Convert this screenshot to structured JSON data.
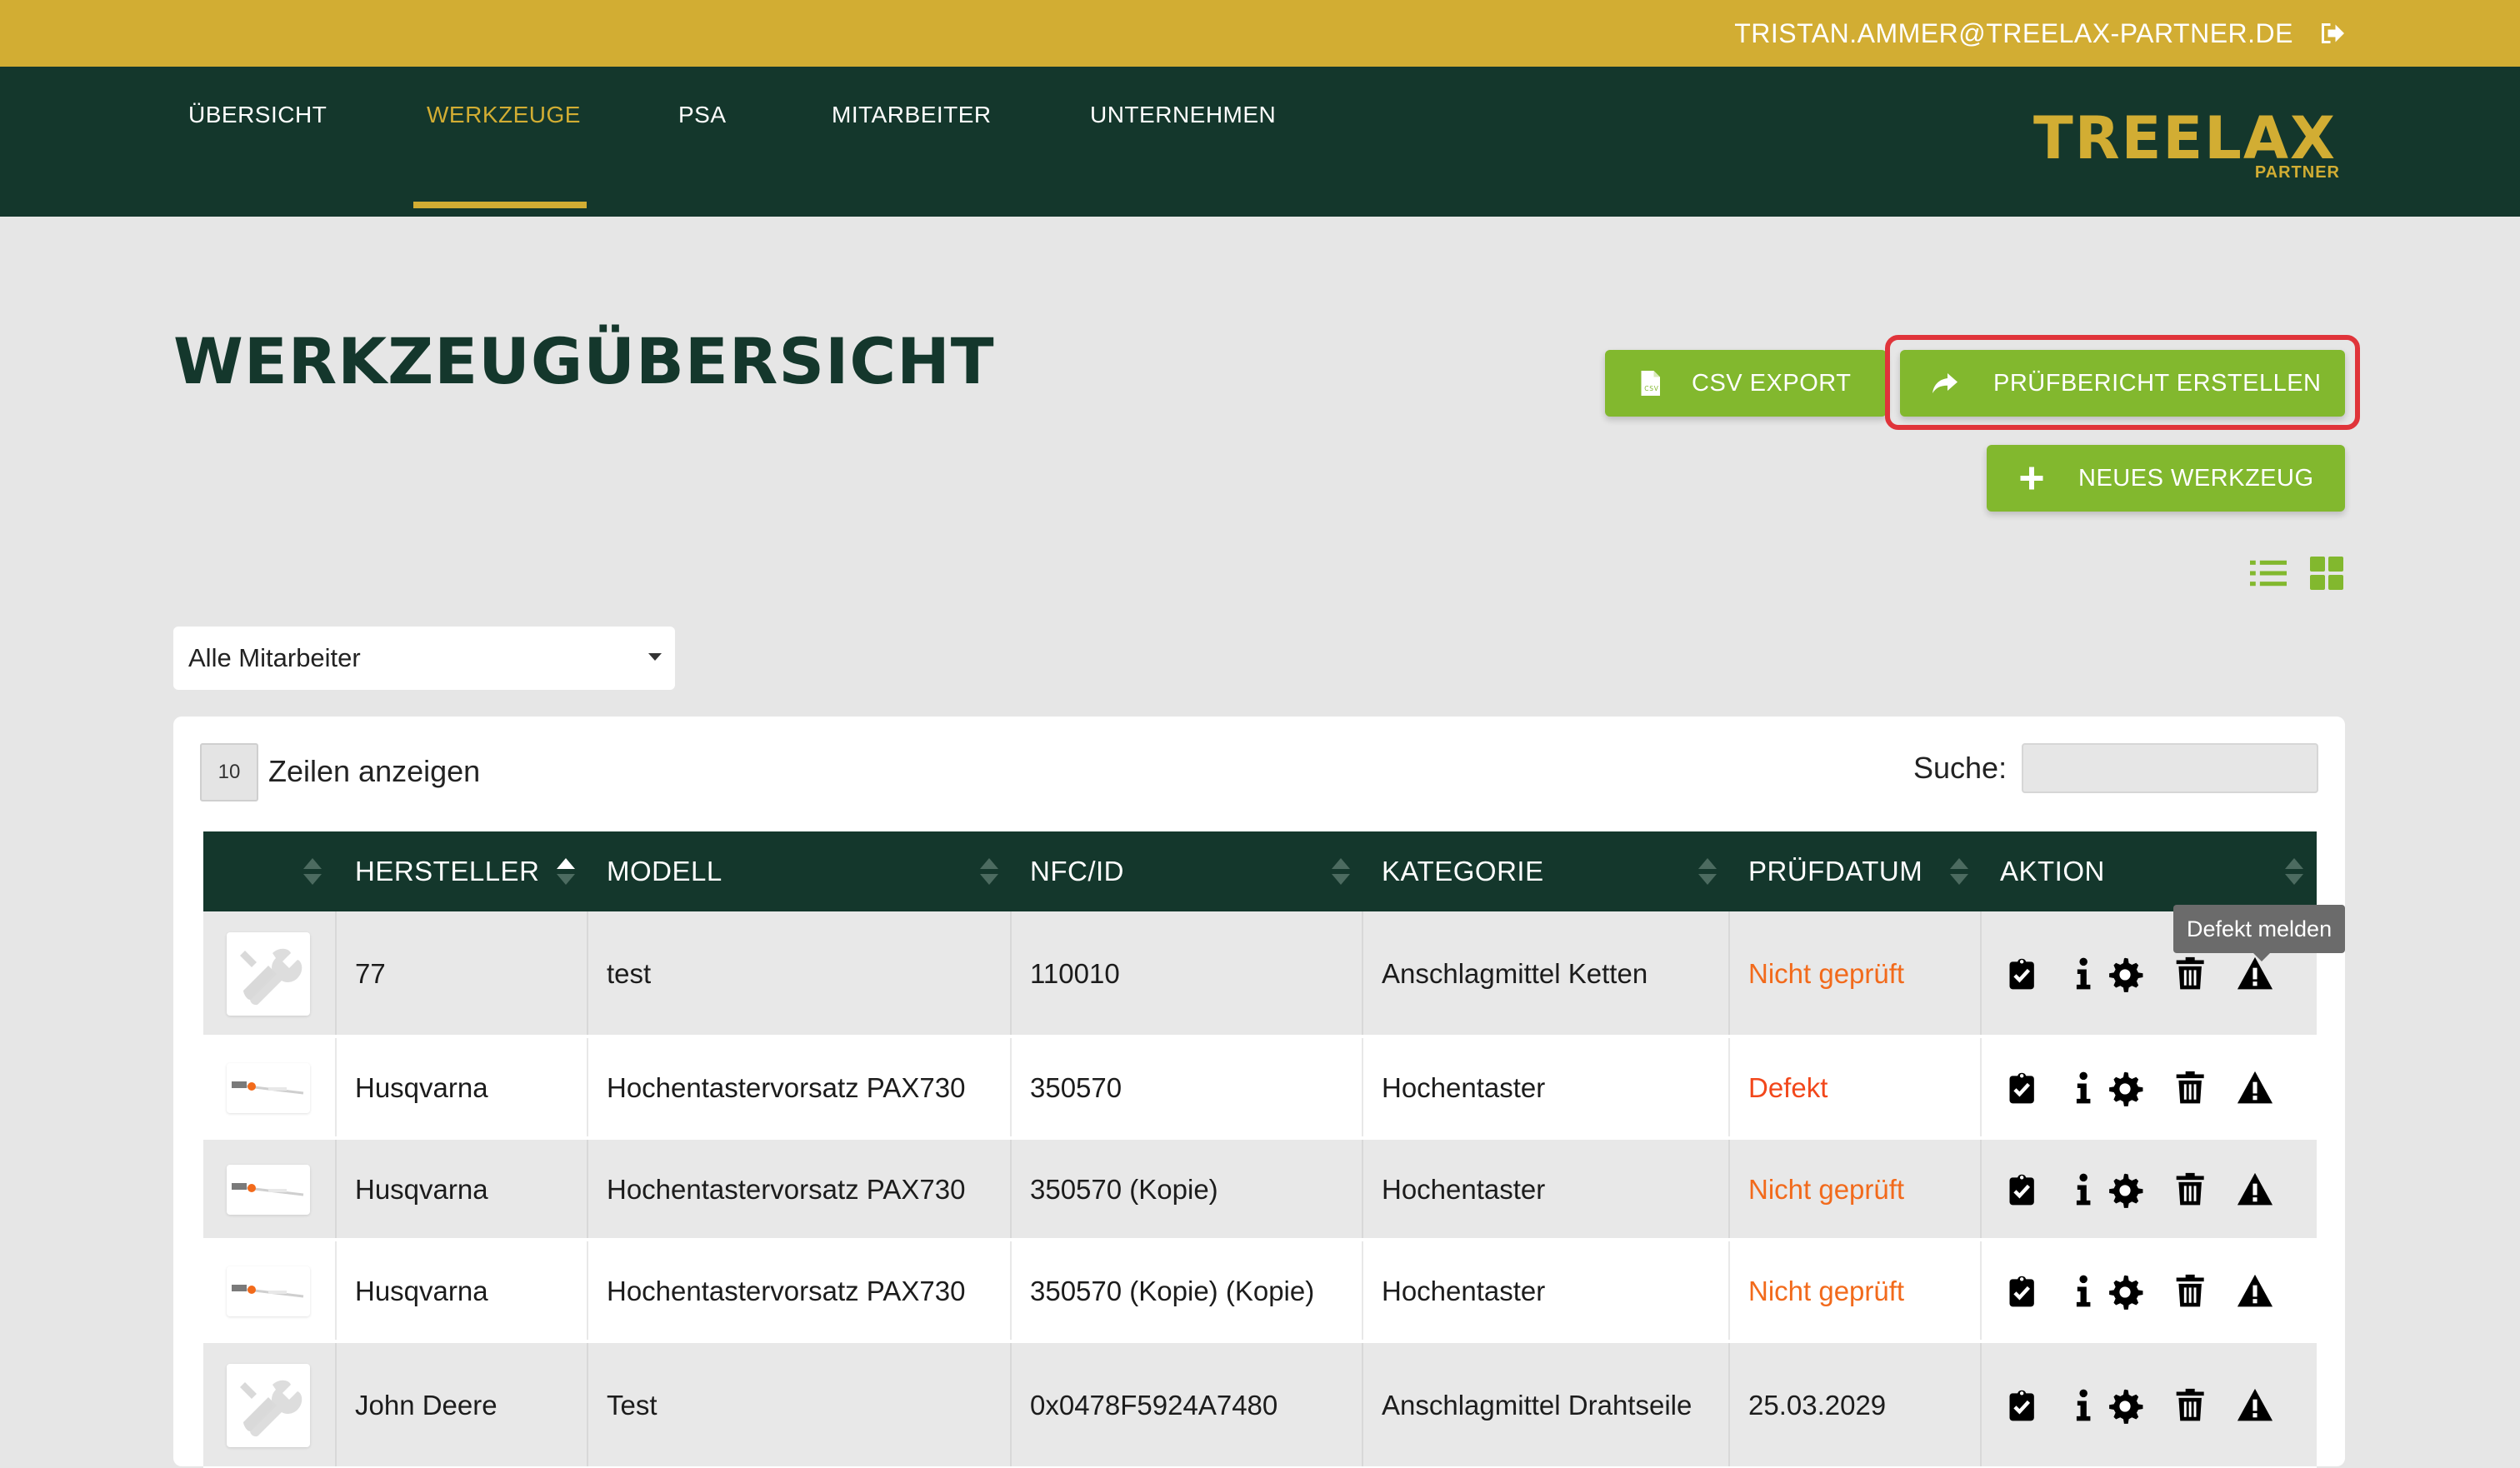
{
  "header": {
    "user_email": "TRISTAN.AMMER@TREELAX-PARTNER.DE",
    "logout_icon": "logout-icon"
  },
  "nav": {
    "items": [
      {
        "label": "ÜBERSICHT",
        "active": false
      },
      {
        "label": "WERKZEUGE",
        "active": true
      },
      {
        "label": "PSA",
        "active": false
      },
      {
        "label": "MITARBEITER",
        "active": false
      },
      {
        "label": "UNTERNEHMEN",
        "active": false
      }
    ],
    "logo_main": "TREELAX",
    "logo_sub": "PARTNER"
  },
  "page": {
    "title": "WERKZEUGÜBERSICHT",
    "buttons": {
      "csv_export": "CSV EXPORT",
      "report": "PRÜFBERICHT ERSTELLEN",
      "new_tool": "NEUES WERKZEUG"
    }
  },
  "filter": {
    "employee_selected": "Alle Mitarbeiter"
  },
  "table_controls": {
    "rows_value": "10",
    "rows_label": "Zeilen anzeigen",
    "search_label": "Suche:",
    "search_value": ""
  },
  "table": {
    "headers": [
      "",
      "HERSTELLER",
      "MODELL",
      "NFC/ID",
      "KATEGORIE",
      "PRÜFDATUM",
      "AKTION"
    ],
    "rows": [
      {
        "image": "tool-placeholder",
        "hersteller": "77",
        "modell": "test",
        "nfc": "110010",
        "kategorie": "Anschlagmittel Ketten",
        "pruefdatum": "Nicht geprüft"
      },
      {
        "image": "pole-saw-photo",
        "hersteller": "Husqvarna",
        "modell": "Hochentastervorsatz PAX730",
        "nfc": "350570",
        "kategorie": "Hochentaster",
        "pruefdatum": "Defekt"
      },
      {
        "image": "pole-saw-photo",
        "hersteller": "Husqvarna",
        "modell": "Hochentastervorsatz PAX730",
        "nfc": "350570 (Kopie)",
        "kategorie": "Hochentaster",
        "pruefdatum": "Nicht geprüft"
      },
      {
        "image": "pole-saw-photo",
        "hersteller": "Husqvarna",
        "modell": "Hochentastervorsatz PAX730",
        "nfc": "350570 (Kopie) (Kopie)",
        "kategorie": "Hochentaster",
        "pruefdatum": "Nicht geprüft"
      },
      {
        "image": "tool-placeholder",
        "hersteller": "John Deere",
        "modell": "Test",
        "nfc": "0x0478F5924A7480",
        "kategorie": "Anschlagmittel Drahtseile",
        "pruefdatum": "25.03.2029"
      }
    ],
    "actions": [
      "clipboard-check-icon",
      "info-icon",
      "gear-icon",
      "trash-icon",
      "warning-icon"
    ]
  },
  "tooltip": {
    "text": "Defekt melden"
  },
  "colors": {
    "topbar": "#d2ad33",
    "navbar": "#14372c",
    "accent_green": "#82b82e",
    "status_orange": "#f26a1b",
    "highlight_red": "#e0343a"
  }
}
